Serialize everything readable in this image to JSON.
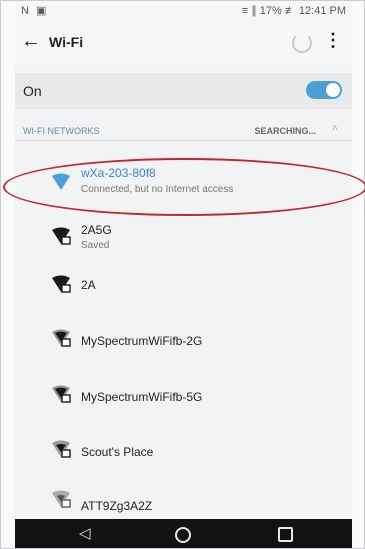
{
  "status_bar": {
    "left_icons": "N  ▣",
    "right_text": "≡ ∥ 17% ≢ 12:41 PM"
  },
  "appbar": {
    "back_icon": "←",
    "title": "Wi-Fi",
    "overflow_icon": "⋮"
  },
  "toggle_row": {
    "label": "On",
    "state": "on",
    "accent": "#4a9fd6"
  },
  "section": {
    "header": "WI-FI NETWORKS",
    "status": "SEARCHING...",
    "caret": "˄"
  },
  "networks": [
    {
      "name": "wXa-203-80f8",
      "status": "Connected, but no Internet access",
      "color": "#3b86c6"
    },
    {
      "name": "2A5G",
      "status": "Saved"
    },
    {
      "name": "2A",
      "status": ""
    },
    {
      "name": "MySpectrumWiFifb-2G",
      "status": ""
    },
    {
      "name": "MySpectrumWiFifb-5G",
      "status": ""
    },
    {
      "name": "Scout's Place",
      "status": ""
    },
    {
      "name": "ATT9Zg3A2Z",
      "status": ""
    }
  ],
  "navbar": {
    "back_icon": "◁"
  },
  "annotation_color": "#c0282e"
}
